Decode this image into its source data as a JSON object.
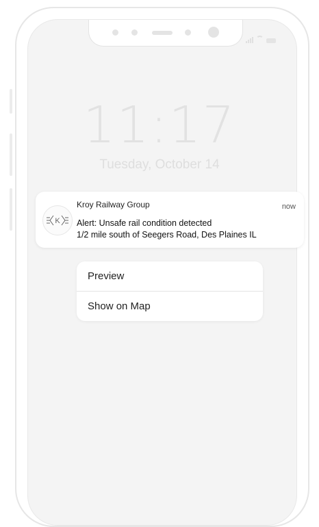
{
  "lockscreen": {
    "time": "11:17",
    "date": "Tuesday, October 14"
  },
  "notification": {
    "app_name": "Kroy Railway Group",
    "timestamp": "now",
    "title": "Alert: Unsafe rail condition detected",
    "body": "1/2 mile south of Seegers Road, Des Plaines IL",
    "icon": "kroy-k-logo-icon",
    "icon_letter": "K"
  },
  "actions": [
    {
      "label": "Preview"
    },
    {
      "label": "Show on Map"
    }
  ],
  "colors": {
    "screen_bg": "#f4f4f4",
    "faded_text": "#e2e2e2",
    "card_bg": "#ffffff"
  }
}
